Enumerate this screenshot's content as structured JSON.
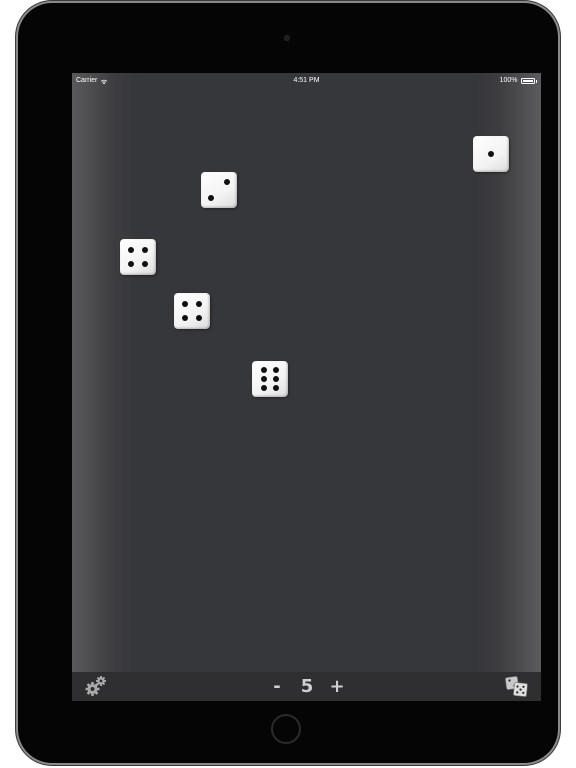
{
  "status_bar": {
    "carrier": "Carrier",
    "time": "4:51 PM",
    "battery": "100%"
  },
  "dice": [
    {
      "name": "die-1",
      "value": 1
    },
    {
      "name": "die-2",
      "value": 2
    },
    {
      "name": "die-3",
      "value": 4
    },
    {
      "name": "die-4",
      "value": 4
    },
    {
      "name": "die-5",
      "value": 6
    }
  ],
  "toolbar": {
    "settings_icon": "gears-icon",
    "decrement_label": "-",
    "dice_count": "5",
    "increment_label": "+",
    "dice_set_icon": "dice-stack-icon"
  },
  "colors": {
    "table": "#36373a",
    "toolbar": "#2f2f31",
    "die_face": "#ffffff",
    "pip": "#101010"
  }
}
